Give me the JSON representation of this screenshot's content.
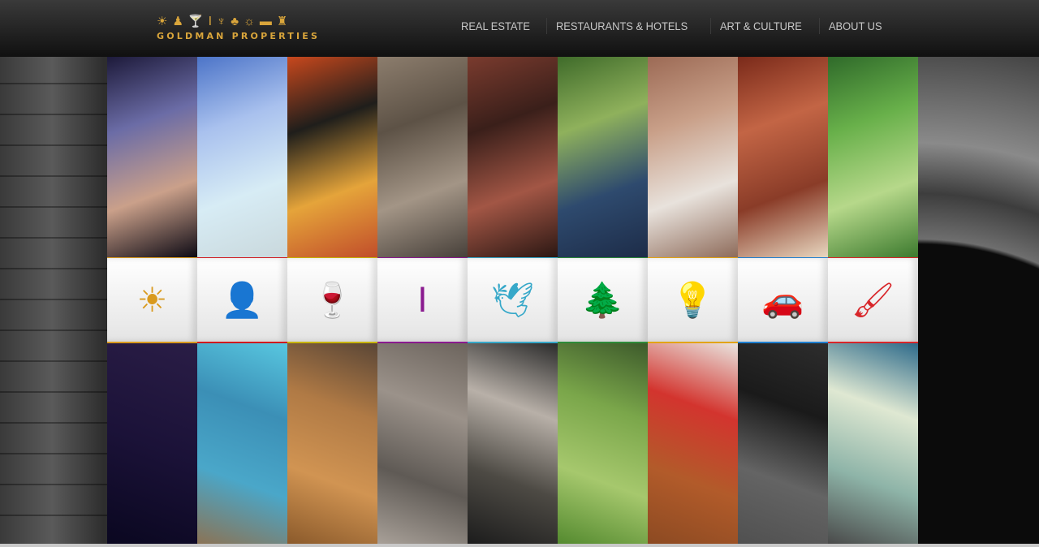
{
  "header": {
    "logo_text": "GOLDMAN PROPERTIES",
    "logo_icons": [
      "sun-icon",
      "bellhop-icon",
      "wine-glass-icon",
      "column-icon",
      "bird-icon",
      "tree-icon",
      "lightbulb-icon",
      "car-icon",
      "paintbrush-icon"
    ]
  },
  "nav": {
    "items": [
      {
        "label": "REAL ESTATE"
      },
      {
        "label": "RESTAURANTS & HOTELS"
      },
      {
        "label": "ART & CULTURE"
      },
      {
        "label": "ABOUT US"
      }
    ]
  },
  "columns": [
    {
      "icon": "sun-icon",
      "glyph": "☀",
      "color": "#d99a1e",
      "top": [
        "#1d1a3a",
        "#6b6ca6",
        "#caa08a",
        "#0d0a14"
      ],
      "bottom": [
        "#2a1d46",
        "#1b1238",
        "#0a0720"
      ]
    },
    {
      "icon": "bellhop-icon",
      "glyph": "👤",
      "color": "#d0191e",
      "top": [
        "#4c74c8",
        "#a9c1ee",
        "#d7ecf5",
        "#c9d8dc"
      ],
      "bottom": [
        "#58c7e0",
        "#3b8fb6",
        "#4aa7c9",
        "#8b7355"
      ]
    },
    {
      "icon": "wine-glass-icon",
      "glyph": "🍷",
      "color": "#c8b400",
      "top": [
        "#c8481d",
        "#1f1e1b",
        "#e5a43a",
        "#c14d2a"
      ],
      "bottom": [
        "#5a4636",
        "#b07a45",
        "#d19452",
        "#8b5a2b"
      ]
    },
    {
      "icon": "column-icon",
      "glyph": "Ⅰ",
      "color": "#8a1a8f",
      "top": [
        "#8c7d6d",
        "#5d5246",
        "#a39586",
        "#47403a"
      ],
      "bottom": [
        "#6c645d",
        "#9b928a",
        "#5f5a55",
        "#a8a098"
      ]
    },
    {
      "icon": "bird-icon",
      "glyph": "🕊",
      "color": "#36a8c9",
      "top": [
        "#7a3b2e",
        "#3a1f1a",
        "#a25645",
        "#2b1713"
      ],
      "bottom": [
        "#2b2b2b",
        "#b8b0a8",
        "#4d4a44",
        "#1c1c1c"
      ]
    },
    {
      "icon": "tree-icon",
      "glyph": "🌲",
      "color": "#2e8b3a",
      "top": [
        "#3f6b2a",
        "#8fb15c",
        "#2e4a6e",
        "#1d2c48"
      ],
      "bottom": [
        "#3d5a2b",
        "#7aa64a",
        "#a6c86d",
        "#548a2f"
      ]
    },
    {
      "icon": "lightbulb-icon",
      "glyph": "💡",
      "color": "#e3a413",
      "top": [
        "#9c6a55",
        "#c9a089",
        "#e8e2dc",
        "#8e6b5a"
      ],
      "bottom": [
        "#e9e5e0",
        "#d3342e",
        "#b25b2a",
        "#8c4a22"
      ]
    },
    {
      "icon": "car-icon",
      "glyph": "🚗",
      "color": "#1e7fd0",
      "top": [
        "#7a2a1a",
        "#c36545",
        "#8a3c28",
        "#e8d7c0"
      ],
      "bottom": [
        "#2d2d2d",
        "#1a1a1a",
        "#646464",
        "#505050"
      ]
    },
    {
      "icon": "paintbrush-icon",
      "glyph": "🖌",
      "color": "#d8262a",
      "top": [
        "#2f6a2a",
        "#68b04a",
        "#b6d88a",
        "#3c7a2e"
      ],
      "bottom": [
        "#2d6a8a",
        "#dfe8d2",
        "#8eb4a8",
        "#4a4a4a"
      ]
    }
  ]
}
